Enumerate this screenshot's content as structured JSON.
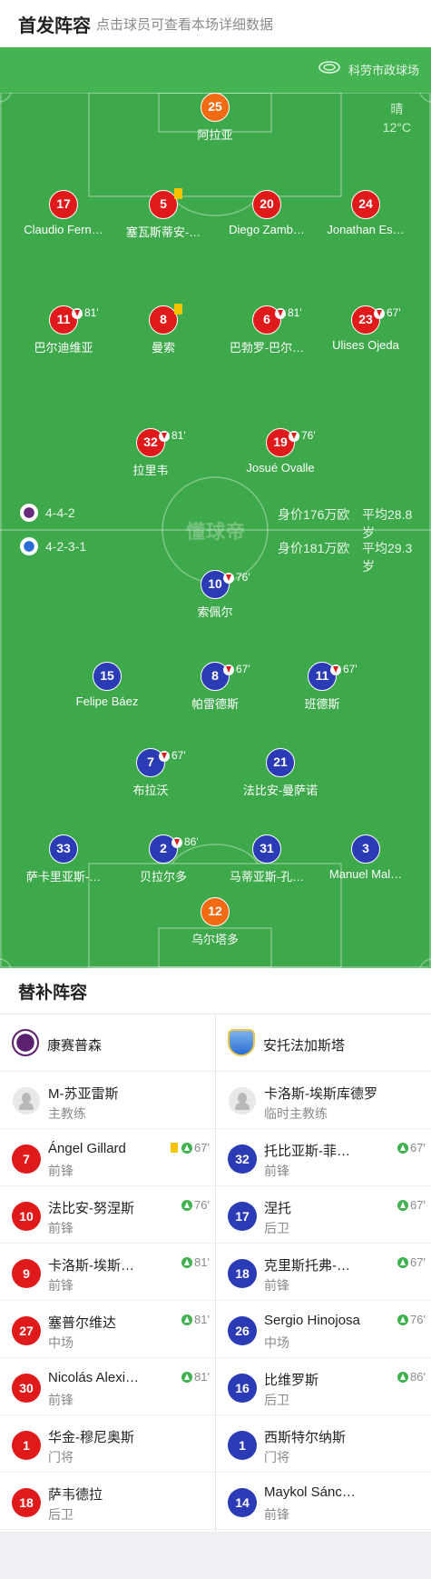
{
  "header": {
    "title": "首发阵容",
    "subtitle": "点击球员可查看本场详细数据"
  },
  "venue": {
    "icon": "stadium-icon",
    "name": "科劳市政球场"
  },
  "weather": {
    "condition": "晴",
    "temp": "12°C"
  },
  "watermark": "懂球帝",
  "home_summary": {
    "formation": "4-4-2",
    "value": "身价176万欧",
    "age": "平均28.8岁"
  },
  "away_summary": {
    "formation": "4-2-3-1",
    "value": "身价181万欧",
    "age": "平均29.3岁"
  },
  "colors": {
    "home": "#e01a1a",
    "keeper_home": "#f26b12",
    "away": "#2a3bb5",
    "keeper_away": "#f26b12",
    "pitch": "#3ea94b"
  },
  "home_lineup": [
    {
      "number": "25",
      "name": "阿拉亚",
      "keeper": true
    },
    {
      "number": "17",
      "name": "Claudio Fern…"
    },
    {
      "number": "5",
      "name": "塞瓦斯蒂安-…",
      "yellow": true
    },
    {
      "number": "20",
      "name": "Diego Zamb…"
    },
    {
      "number": "24",
      "name": "Jonathan Es…"
    },
    {
      "number": "11",
      "name": "巴尔迪维亚",
      "sub_off": "81'"
    },
    {
      "number": "8",
      "name": "曼索",
      "yellow": true
    },
    {
      "number": "6",
      "name": "巴勃罗-巴尔…",
      "sub_off": "81'"
    },
    {
      "number": "23",
      "name": "Ulises Ojeda",
      "sub_off": "67'"
    },
    {
      "number": "32",
      "name": "拉里韦",
      "sub_off": "81'"
    },
    {
      "number": "19",
      "name": "Josué Ovalle",
      "sub_off": "76'"
    }
  ],
  "away_lineup": [
    {
      "number": "10",
      "name": "索佩尔",
      "sub_off": "76'"
    },
    {
      "number": "15",
      "name": "Felipe Báez"
    },
    {
      "number": "8",
      "name": "帕雷德斯",
      "sub_off": "67'"
    },
    {
      "number": "11",
      "name": "班德斯",
      "sub_off": "67'"
    },
    {
      "number": "7",
      "name": "布拉沃",
      "sub_off": "67'"
    },
    {
      "number": "21",
      "name": "法比安-曼萨诺"
    },
    {
      "number": "33",
      "name": "萨卡里亚斯-…"
    },
    {
      "number": "2",
      "name": "贝拉尔多",
      "sub_off": "86'"
    },
    {
      "number": "31",
      "name": "马蒂亚斯-孔…"
    },
    {
      "number": "3",
      "name": "Manuel Mal…"
    },
    {
      "number": "12",
      "name": "乌尔塔多",
      "keeper": true
    }
  ],
  "bench": {
    "title": "替补阵容",
    "home": {
      "team": "康赛普森",
      "coach": {
        "name": "M-苏亚雷斯",
        "role": "主教练"
      },
      "players": [
        {
          "number": "7",
          "name": "Ángel Gillard",
          "pos": "前锋",
          "yellow": true,
          "sub_on": "67'"
        },
        {
          "number": "10",
          "name": "法比安-努涅斯",
          "pos": "前锋",
          "sub_on": "76'"
        },
        {
          "number": "9",
          "name": "卡洛斯-埃斯…",
          "pos": "前锋",
          "sub_on": "81'"
        },
        {
          "number": "27",
          "name": "塞普尔维达",
          "pos": "中场",
          "sub_on": "81'"
        },
        {
          "number": "30",
          "name": "Nicolás Alexi…",
          "pos": "前锋",
          "sub_on": "81'"
        },
        {
          "number": "1",
          "name": "华金-穆尼奥斯",
          "pos": "门将"
        },
        {
          "number": "18",
          "name": "萨韦德拉",
          "pos": "后卫"
        }
      ]
    },
    "away": {
      "team": "安托法加斯塔",
      "coach": {
        "name": "卡洛斯-埃斯库德罗",
        "role": "临时主教练"
      },
      "players": [
        {
          "number": "32",
          "name": "托比亚斯-菲…",
          "pos": "前锋",
          "sub_on": "67'"
        },
        {
          "number": "17",
          "name": "涅托",
          "pos": "后卫",
          "sub_on": "67'"
        },
        {
          "number": "18",
          "name": "克里斯托弗-…",
          "pos": "前锋",
          "sub_on": "67'"
        },
        {
          "number": "26",
          "name": "Sergio Hinojosa",
          "pos": "中场",
          "sub_on": "76'"
        },
        {
          "number": "16",
          "name": "比维罗斯",
          "pos": "后卫",
          "sub_on": "86'"
        },
        {
          "number": "1",
          "name": "西斯特尔纳斯",
          "pos": "门将"
        },
        {
          "number": "14",
          "name": "Maykol Sánc…",
          "pos": "前锋"
        }
      ]
    }
  }
}
